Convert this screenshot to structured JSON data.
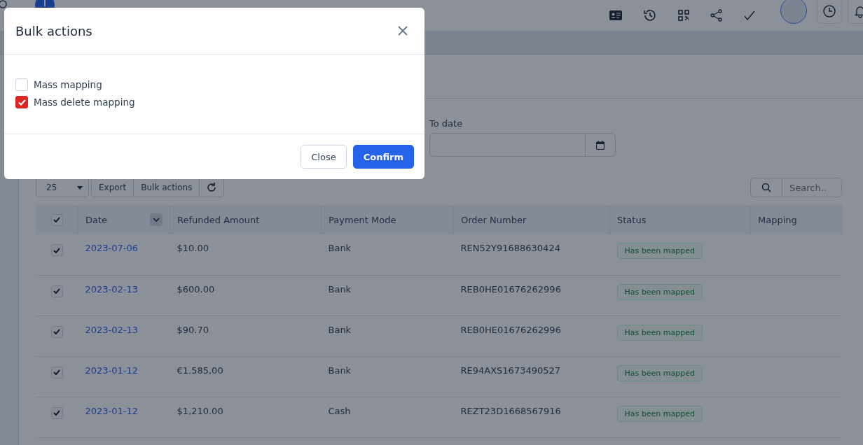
{
  "toolbar": {
    "page_size": "25",
    "buttons": [
      "Export",
      "Bulk actions"
    ],
    "search": {
      "placeholder": "Search.."
    }
  },
  "filters": {
    "to_date": {
      "label": "To date"
    }
  },
  "table": {
    "all_checked": true,
    "columns": [
      "Date",
      "Refunded Amount",
      "Payment Mode",
      "Order Number",
      "Status",
      "Mapping"
    ],
    "rows": [
      {
        "checked": true,
        "date": "2023-07-06",
        "amount": "$10.00",
        "mode": "Bank",
        "order": "REN52Y91688630424",
        "status": "Has been mapped"
      },
      {
        "checked": true,
        "date": "2023-02-13",
        "amount": "$600.00",
        "mode": "Bank",
        "order": "REB0HE01676262996",
        "status": "Has been mapped"
      },
      {
        "checked": true,
        "date": "2023-02-13",
        "amount": "$90.70",
        "mode": "Bank",
        "order": "REB0HE01676262996",
        "status": "Has been mapped"
      },
      {
        "checked": true,
        "date": "2023-01-12",
        "amount": "€1.585,00",
        "mode": "Bank",
        "order": "RE94AXS1673490527",
        "status": "Has been mapped"
      },
      {
        "checked": true,
        "date": "2023-01-12",
        "amount": "$1,210.00",
        "mode": "Cash",
        "order": "REZT23D1668567916",
        "status": "Has been mapped"
      }
    ]
  },
  "modal": {
    "title": "Bulk actions",
    "options": [
      {
        "label": "Mass mapping",
        "checked": false
      },
      {
        "label": "Mass delete mapping",
        "checked": true
      }
    ],
    "buttons": [
      {
        "label": "Close",
        "kind": "secondary"
      },
      {
        "label": "Confirm",
        "kind": "primary"
      }
    ]
  }
}
